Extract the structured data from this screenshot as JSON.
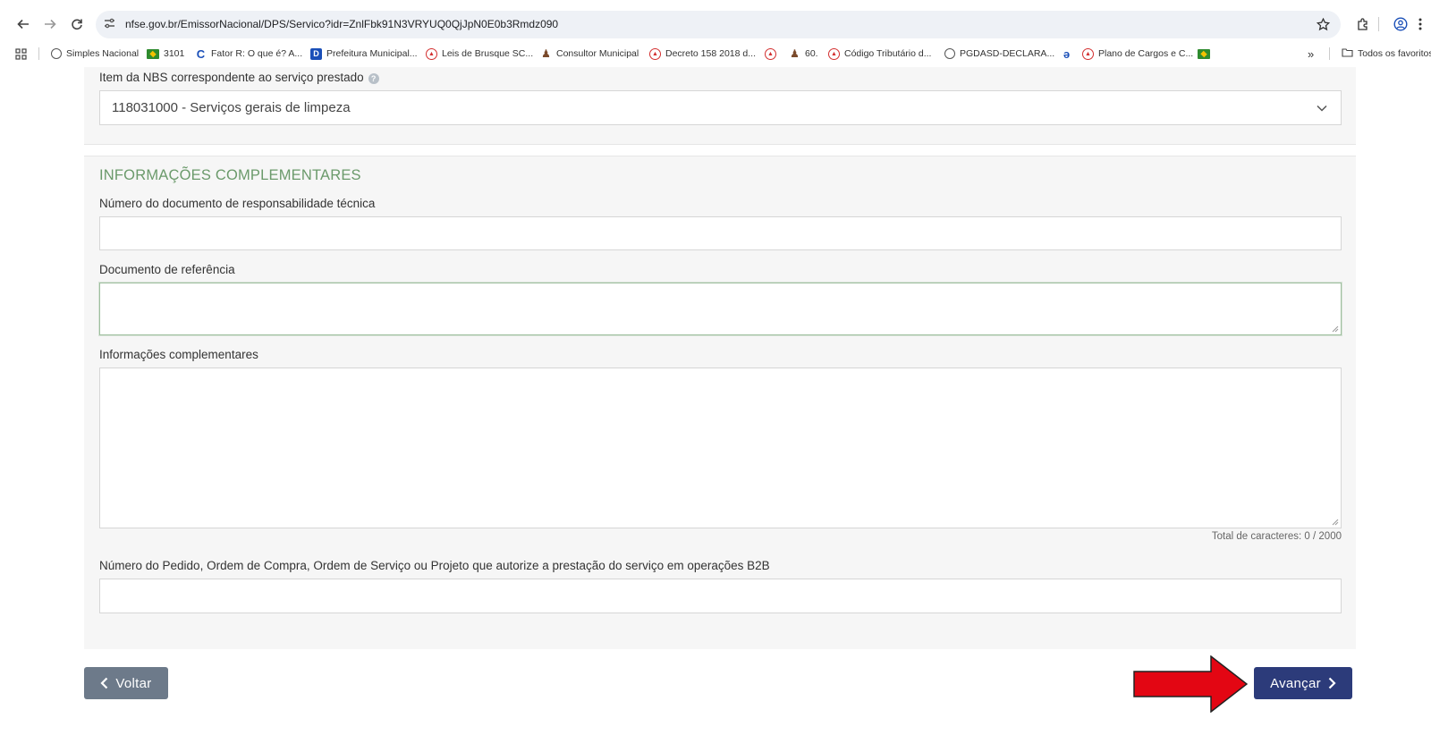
{
  "browser": {
    "url": "nfse.gov.br/EmissorNacional/DPS/Servico?idr=ZnlFbk91N3VRYUQ0QjJpN0E0b3Rmdz090",
    "bookmarks": [
      {
        "label": "Simples Nacional",
        "icon": "globe-icon"
      },
      {
        "label": "3101",
        "icon": "brazil-flag-icon"
      },
      {
        "label": "Fator R: O que é? A...",
        "icon": "c-logo-icon"
      },
      {
        "label": "Prefeitura Municipal...",
        "icon": "d-logo-icon"
      },
      {
        "label": "Leis de Brusque SC...",
        "icon": "red-circle-icon"
      },
      {
        "label": "Consultor Municipal",
        "icon": "person-icon"
      },
      {
        "label": "Decreto 158 2018 d...",
        "icon": "red-circle-icon"
      },
      {
        "label": "",
        "icon": "red-circle-icon"
      },
      {
        "label": "60.",
        "icon": "person-icon"
      },
      {
        "label": "Código Tributário d...",
        "icon": "red-circle-icon"
      },
      {
        "label": "PGDASD-DECLARA...",
        "icon": "globe-icon"
      },
      {
        "label": "",
        "icon": "edge-icon"
      },
      {
        "label": "Plano de Cargos e C...",
        "icon": "red-circle-icon"
      },
      {
        "label": "",
        "icon": "brazil-flag-icon"
      }
    ],
    "overflow_label": "»",
    "all_favorites_label": "Todos os favoritos"
  },
  "form": {
    "nbs": {
      "label": "Item da NBS correspondente ao serviço prestado",
      "help": "?",
      "value": "118031000 - Serviços gerais de limpeza"
    },
    "section_title": "INFORMAÇÕES COMPLEMENTARES",
    "tech_doc": {
      "label": "Número do documento de responsabilidade técnica",
      "value": ""
    },
    "ref_doc": {
      "label": "Documento de referência",
      "value": ""
    },
    "extra_info": {
      "label": "Informações complementares",
      "value": ""
    },
    "counter": "Total de caracteres: 0 / 2000",
    "order_number": {
      "label": "Número do Pedido, Ordem de Compra, Ordem de Serviço ou Projeto que autorize a prestação do serviço em operações B2B",
      "value": ""
    }
  },
  "buttons": {
    "back": "Voltar",
    "next": "Avançar"
  },
  "colors": {
    "section_title": "#6b9a6b",
    "next_button": "#2c3b7a",
    "back_button": "#6d7a8a",
    "annotation_arrow": "#e30613"
  }
}
